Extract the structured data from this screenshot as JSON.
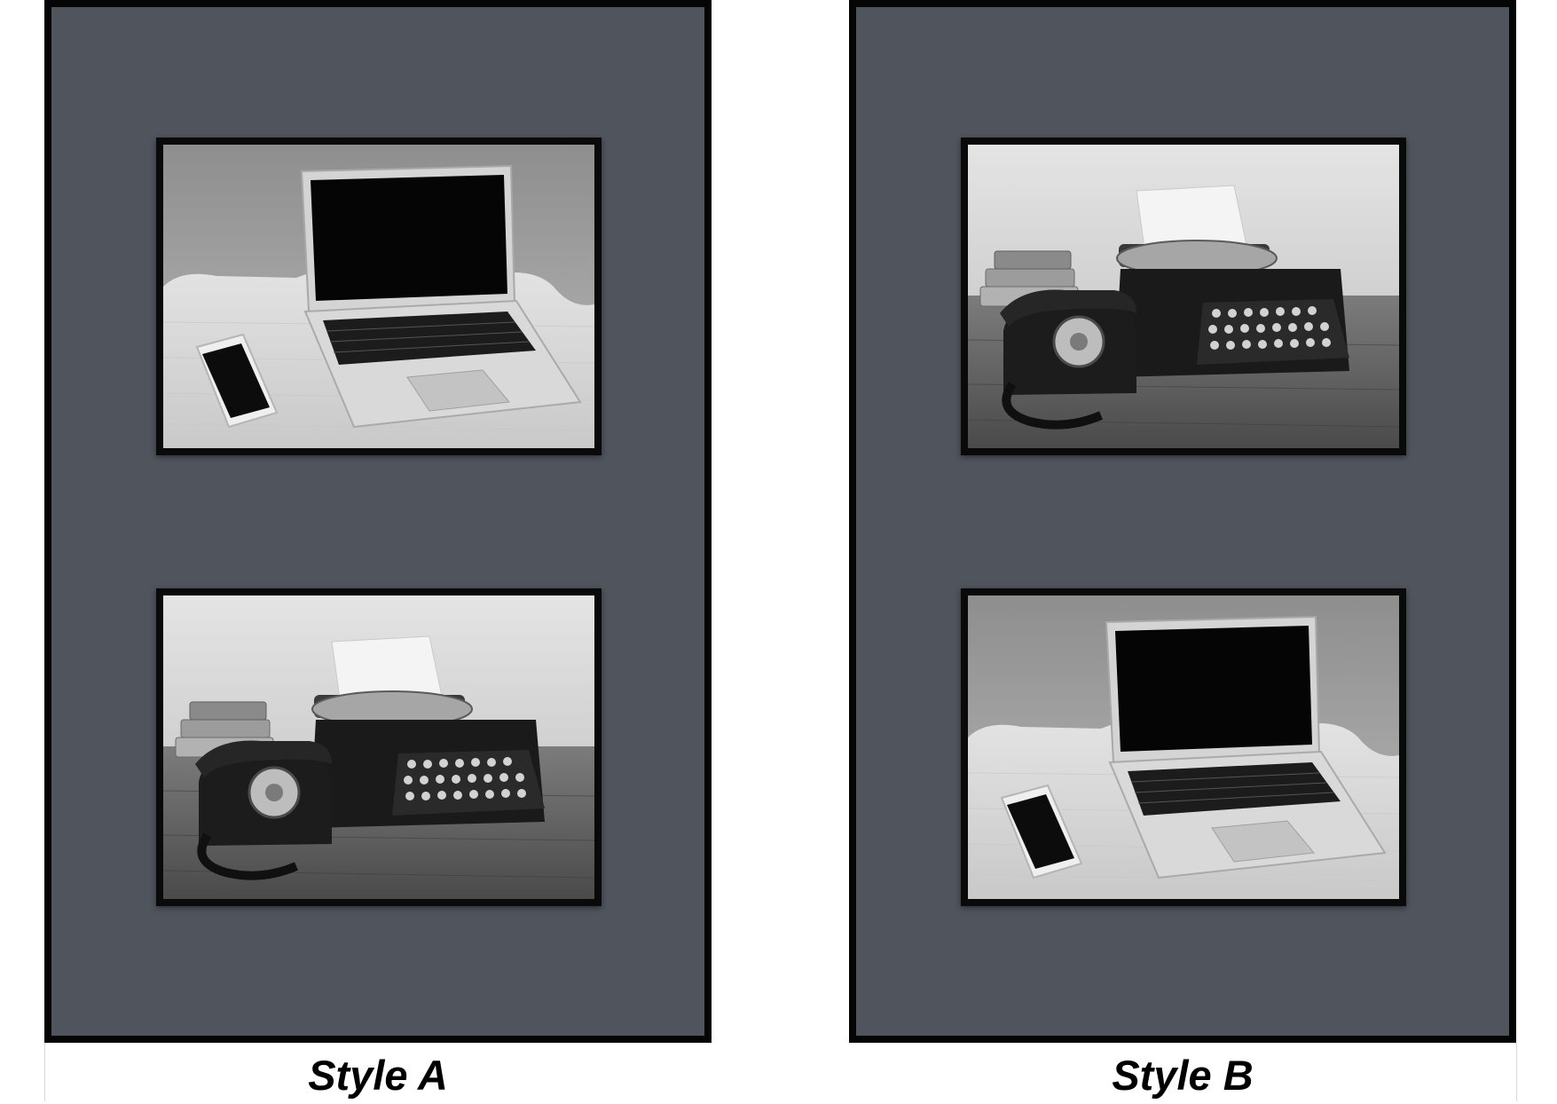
{
  "captions": {
    "style_a": "Style A",
    "style_b": "Style B"
  },
  "colors": {
    "mat": "#4f545d",
    "border": "#050505",
    "background": "#ffffff"
  },
  "style_a": {
    "top_photo": "laptop-and-phone-photo",
    "bottom_photo": "typewriter-and-rotary-phone-photo"
  },
  "style_b": {
    "top_photo": "typewriter-and-rotary-phone-photo",
    "bottom_photo": "laptop-and-phone-photo"
  }
}
